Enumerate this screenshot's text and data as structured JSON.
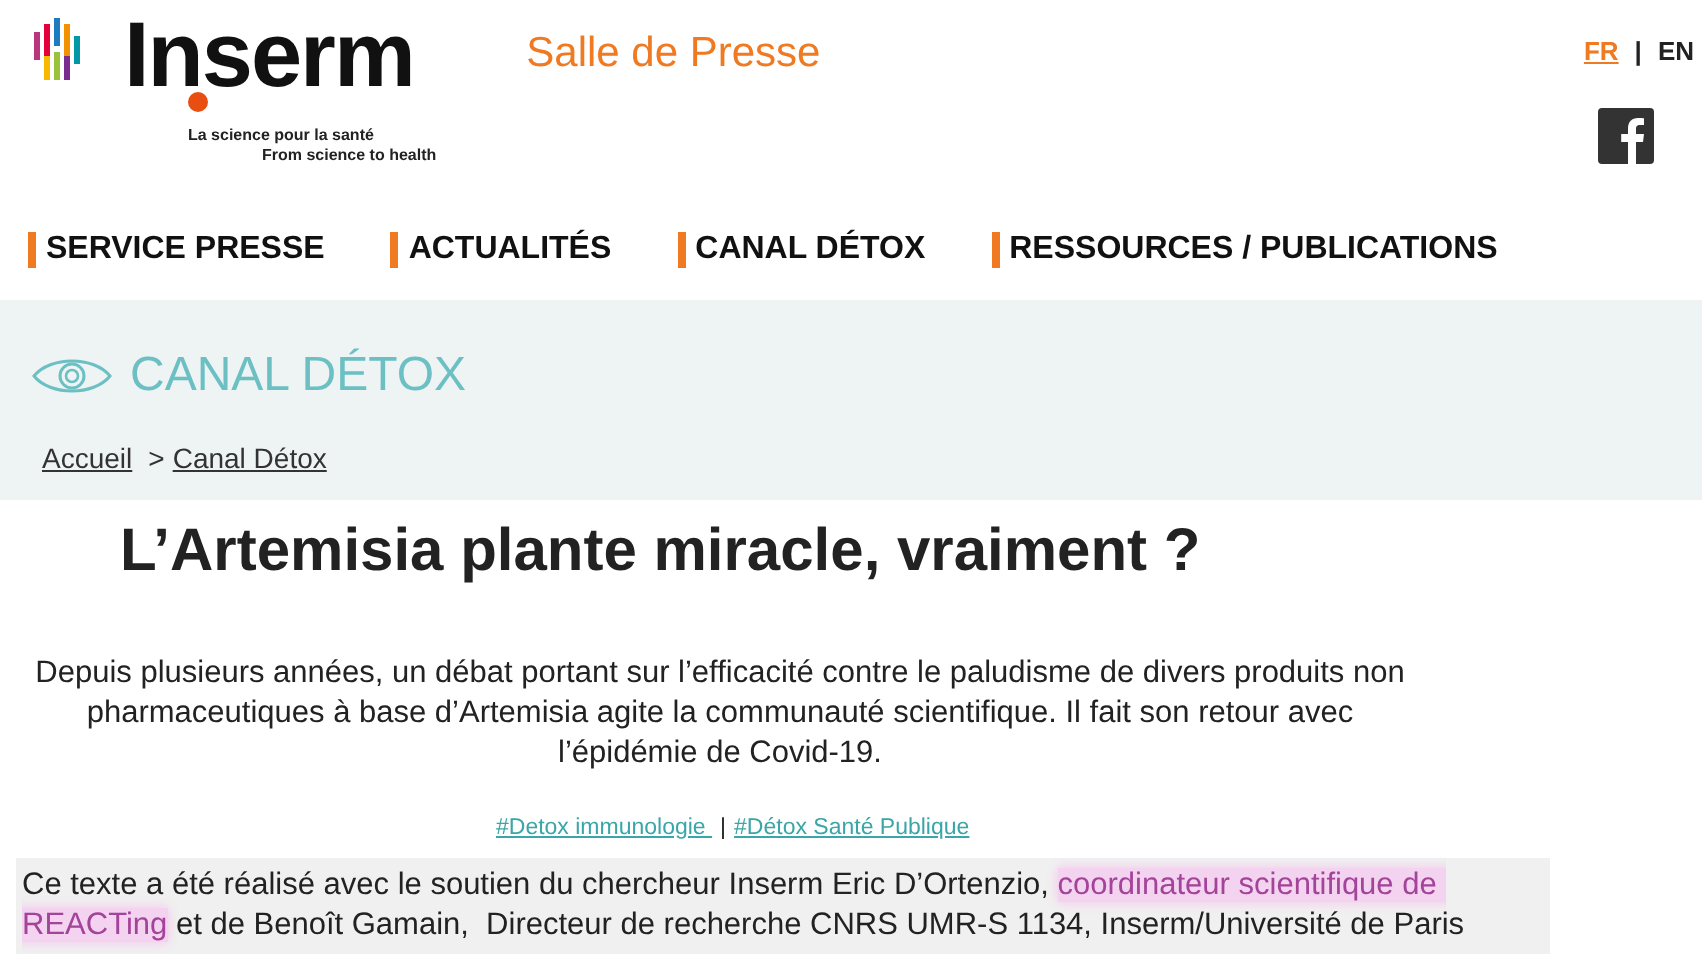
{
  "logo": {
    "name": "Inserm",
    "tagline_fr": "La science pour la santé",
    "tagline_en": "From science to health"
  },
  "site_title": "Salle de Presse",
  "languages": [
    {
      "label": "FR",
      "selected": true
    },
    {
      "label": "EN",
      "selected": false
    }
  ],
  "language_separator": "|",
  "nav": [
    "SERVICE PRESSE",
    "ACTUALITÉS",
    "CANAL DÉTOX",
    "RESSOURCES / PUBLICATIONS"
  ],
  "section": {
    "title": "CANAL DÉTOX",
    "breadcrumb": [
      "Accueil",
      "Canal Détox"
    ],
    "breadcrumb_separator": ">"
  },
  "article": {
    "title": "L’Artemisia plante miracle, vraiment ?",
    "intro": "Depuis plusieurs années, un débat portant sur l’efficacité contre le paludisme de divers produits non pharmaceutiques à base d’Artemisia agite la communauté scientifique. Il fait son retour avec l’épidémie de Covid-19.",
    "tags": [
      "#Detox immunologie ",
      "#Détox Santé Publique"
    ],
    "tag_separator": "|",
    "credit": [
      {
        "text": "Ce texte a été réalisé avec le soutien du chercheur Inserm Eric D’Ortenzio, ",
        "highlighted": false
      },
      {
        "text": "coordinateur scientifique de REACTing",
        "highlighted": true
      },
      {
        "text": " et de Benoît Gamain,  Directeur de recherche CNRS UMR-S 1134, Inserm/Université de Paris",
        "highlighted": false
      }
    ]
  }
}
